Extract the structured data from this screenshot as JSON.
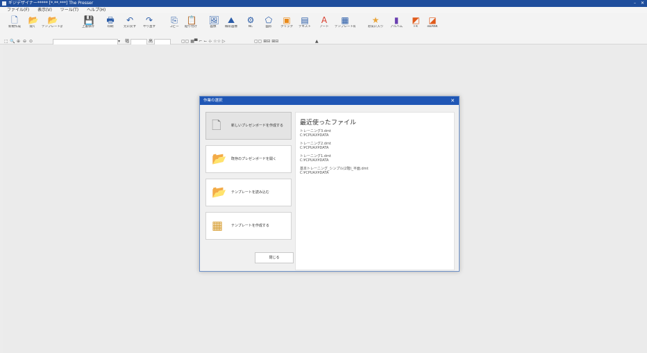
{
  "window": {
    "title": "ギジデザイナー***** [*.**.***] The Presser",
    "minimize": "–",
    "close": "✕"
  },
  "menu": [
    "ファイル(F)",
    "表示(V)",
    "ツール(T)",
    "ヘルプ(H)"
  ],
  "toolbar": [
    {
      "label": "新規作成",
      "icon": "new-file-icon",
      "glyph": "🗋"
    },
    {
      "label": "開く",
      "icon": "open-folder-icon",
      "glyph": "📂"
    },
    {
      "label": "テンプレート読込",
      "icon": "template-load-icon",
      "glyph": "📂"
    },
    {
      "label": "上書保存",
      "icon": "save-icon",
      "glyph": "💾"
    },
    {
      "label": "印刷",
      "icon": "print-icon",
      "glyph": "🖶"
    },
    {
      "label": "元に戻す",
      "icon": "undo-icon",
      "glyph": "↶"
    },
    {
      "label": "やり直す",
      "icon": "redo-icon",
      "glyph": "↷"
    },
    {
      "label": "コピー",
      "icon": "copy-icon",
      "glyph": "⎘"
    },
    {
      "label": "貼り付け",
      "icon": "paste-icon",
      "glyph": "📋"
    },
    {
      "label": "画像",
      "icon": "image-icon",
      "glyph": "🖼"
    },
    {
      "label": "線形画像",
      "icon": "linear-image-icon",
      "glyph": "⛰"
    },
    {
      "label": "NC",
      "icon": "nc-icon",
      "glyph": "⚙"
    },
    {
      "label": "図形",
      "icon": "shape-icon",
      "glyph": "⬠"
    },
    {
      "label": "クリック",
      "icon": "click-icon",
      "glyph": "▣"
    },
    {
      "label": "テキスト",
      "icon": "textbox-icon",
      "glyph": "▤"
    },
    {
      "label": "アート",
      "icon": "art-text-icon",
      "glyph": "A"
    },
    {
      "label": "テンプレート枠",
      "icon": "template-frame-icon",
      "glyph": "▦"
    },
    {
      "label": "お気に入り",
      "icon": "favorite-star-icon",
      "glyph": "★"
    },
    {
      "label": "アルバム",
      "icon": "album-icon",
      "glyph": "▮"
    },
    {
      "label": "FR",
      "icon": "fr-icon",
      "glyph": "◩"
    },
    {
      "label": "eBANK",
      "icon": "ebank-icon",
      "glyph": "◪"
    }
  ],
  "format_bar": {
    "width_label": "幅",
    "height_label": "高"
  },
  "dialog": {
    "title": "作業の選択",
    "close": "✕",
    "options": [
      {
        "label": "新しいプレゼンボードを作成する",
        "icon": "new-board-icon",
        "glyph": "🗋",
        "selected": true
      },
      {
        "label": "既存のプレゼンボードを開く",
        "icon": "open-board-icon",
        "glyph": "📂",
        "selected": false
      },
      {
        "label": "テンプレートを読み込む",
        "icon": "load-template-icon",
        "glyph": "📂",
        "selected": false
      },
      {
        "label": "テンプレートを作成する",
        "icon": "create-template-icon",
        "glyph": "▦",
        "selected": false
      }
    ],
    "recent_title": "最近使ったファイル",
    "recent_files": [
      {
        "name": "トレーニング3.dmt",
        "path": "C:¥CPUAX¥DATA"
      },
      {
        "name": "トレーニング2.dmt",
        "path": "C:¥CPUAX¥DATA"
      },
      {
        "name": "トレーニング1.dmt",
        "path": "C:¥CPUAX¥DATA"
      },
      {
        "name": "基本トレーニング_シンプル(2階)_平面.dmt",
        "path": "C:¥CPUAX¥DATA"
      }
    ],
    "close_button": "閉じる"
  },
  "colors": {
    "titlebar": "#1f4e9c",
    "dialog_header": "#1f56b5",
    "accent_orange": "#e98a1a"
  }
}
